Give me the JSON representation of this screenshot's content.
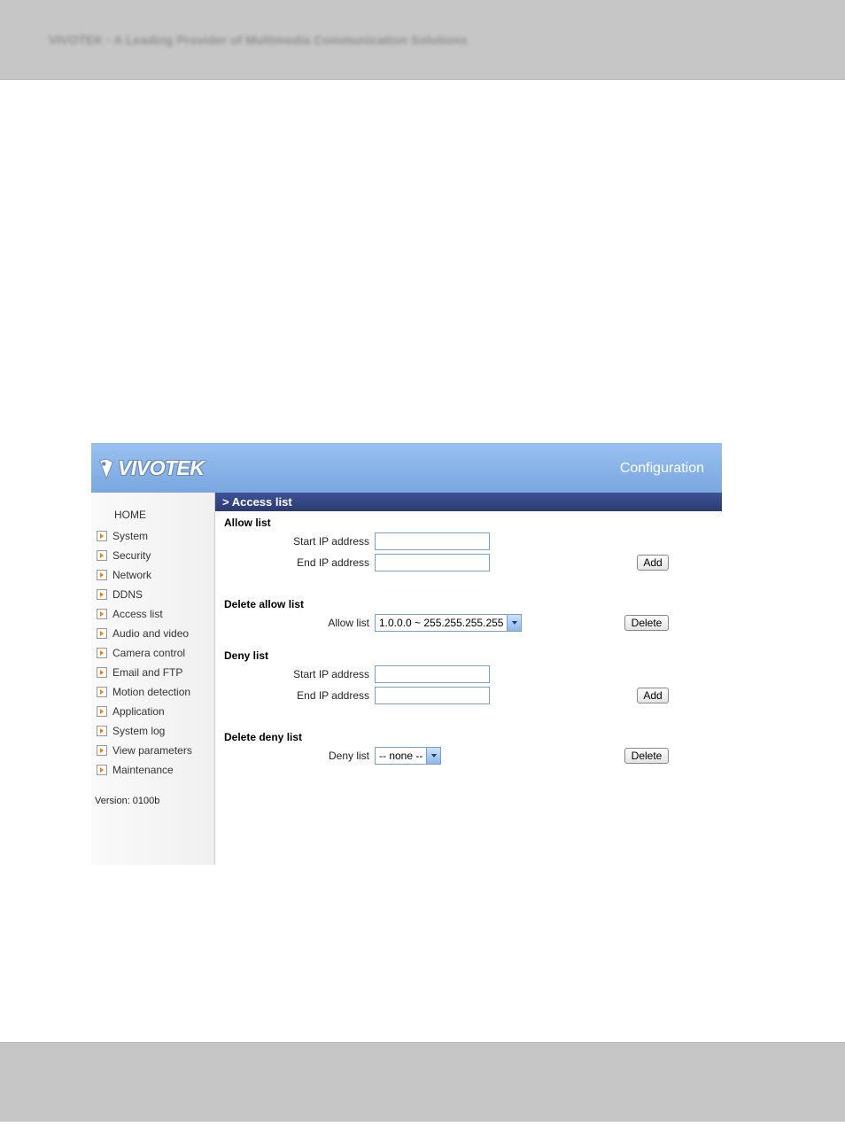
{
  "page_header_blurred": "VIVOTEK - A Leading Provider of Multimedia Communication Solutions",
  "header": {
    "brand": "VIVOTEK",
    "right_label": "Configuration"
  },
  "sidebar": {
    "home": "HOME",
    "items": [
      "System",
      "Security",
      "Network",
      "DDNS",
      "Access list",
      "Audio and video",
      "Camera control",
      "Email and FTP",
      "Motion detection",
      "Application",
      "System log",
      "View parameters",
      "Maintenance"
    ],
    "version": "Version: 0100b"
  },
  "content": {
    "title": "> Access list",
    "allow": {
      "heading": "Allow list",
      "start_label": "Start IP address",
      "start_value": "",
      "end_label": "End IP address",
      "end_value": "",
      "add_btn": "Add"
    },
    "delete_allow": {
      "heading": "Delete allow list",
      "label": "Allow list",
      "selected": "1.0.0.0 ~ 255.255.255.255",
      "delete_btn": "Delete"
    },
    "deny": {
      "heading": "Deny list",
      "start_label": "Start IP address",
      "start_value": "",
      "end_label": "End IP address",
      "end_value": "",
      "add_btn": "Add"
    },
    "delete_deny": {
      "heading": "Delete deny list",
      "label": "Deny list",
      "selected": "-- none --",
      "delete_btn": "Delete"
    }
  }
}
